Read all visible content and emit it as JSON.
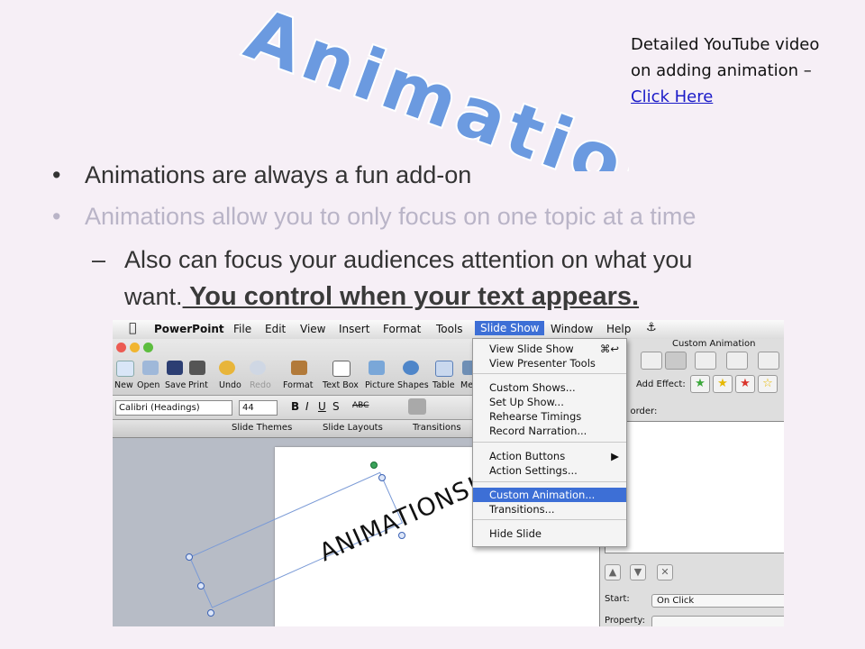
{
  "slide": {
    "title": "Animation",
    "youtube_note": {
      "text_line1": "Detailed YouTube video",
      "text_line2": "on adding animation –",
      "link": "Click Here"
    },
    "bullets": [
      {
        "text": "Animations are always a fun add-on",
        "color": "#333333"
      },
      {
        "text": "Animations allow you to only focus on one topic at a time",
        "color": "#b9b4c7"
      }
    ],
    "sub_bullet": {
      "text_line1": "Also can focus your audiences attention on what you",
      "text_line2": "want.",
      "highlight": " You control when your text appears."
    },
    "bullet_char": "•",
    "dash_char": "–",
    "title_color": "#6b9ae0"
  },
  "screenshot": {
    "menubar": {
      "app": "PowerPoint",
      "items": [
        "File",
        "Edit",
        "View",
        "Insert",
        "Format",
        "Tools",
        "Slide Show",
        "Window",
        "Help"
      ],
      "active": "Slide Show"
    },
    "toolbar": [
      "New",
      "Open",
      "Save",
      "Print",
      "Undo",
      "Redo",
      "Format",
      "Text Box",
      "Picture",
      "Shapes",
      "Table",
      "Me"
    ],
    "font": {
      "name": "Calibri (Headings)",
      "size": "44"
    },
    "ribbon_tabs": [
      "Slide Themes",
      "Slide Layouts",
      "Transitions"
    ],
    "slide_text": "ANIMATIONS!!",
    "menu": {
      "items": [
        {
          "label": "View Slide Show",
          "shortcut": "⌘↩"
        },
        {
          "label": "View Presenter Tools",
          "shortcut": ""
        },
        {
          "label": "Custom Shows...",
          "shortcut": ""
        },
        {
          "label": "Set Up Show...",
          "shortcut": ""
        },
        {
          "label": "Rehearse Timings",
          "shortcut": ""
        },
        {
          "label": "Record Narration...",
          "shortcut": ""
        },
        {
          "label": "Action Buttons",
          "shortcut": "▶"
        },
        {
          "label": "Action Settings...",
          "shortcut": ""
        },
        {
          "label": "Custom Animation...",
          "shortcut": ""
        },
        {
          "label": "Transitions...",
          "shortcut": ""
        },
        {
          "label": "Hide Slide",
          "shortcut": ""
        }
      ],
      "selected": "Custom Animation..."
    },
    "panel": {
      "title": "Custom Animation",
      "add_effect": "Add Effect:",
      "order_label": "ation order:",
      "start_label": "Start:",
      "start_value": "On Click",
      "property_label": "Property:"
    }
  }
}
